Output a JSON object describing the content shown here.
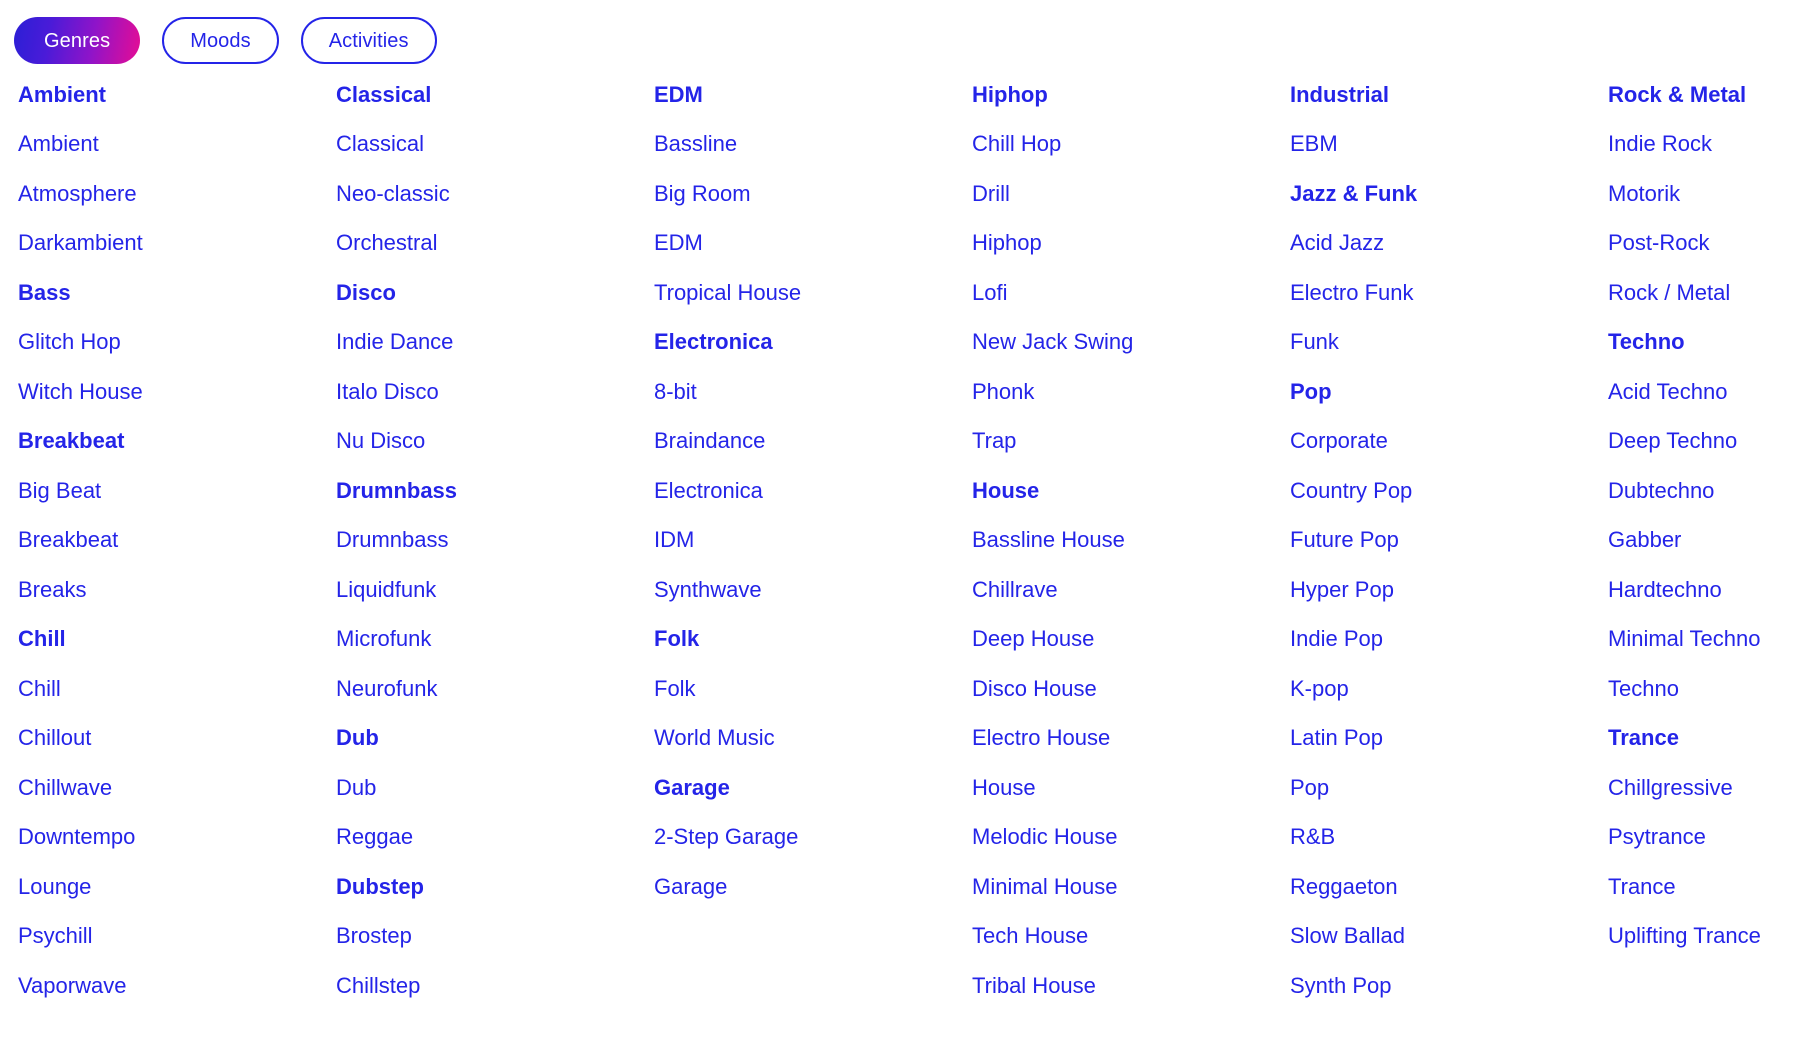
{
  "tabs": [
    {
      "label": "Genres",
      "active": true
    },
    {
      "label": "Moods",
      "active": false
    },
    {
      "label": "Activities",
      "active": false
    }
  ],
  "colors": {
    "link": "#2424e8",
    "pill_gradient_start": "#2b1fd6",
    "pill_gradient_end": "#e60c94",
    "pill_border": "#2424e8",
    "background": "#ffffff"
  },
  "columns": [
    {
      "entries": [
        {
          "type": "group",
          "label": "Ambient"
        },
        {
          "type": "item",
          "label": "Ambient"
        },
        {
          "type": "item",
          "label": "Atmosphere"
        },
        {
          "type": "item",
          "label": "Darkambient"
        },
        {
          "type": "group",
          "label": "Bass"
        },
        {
          "type": "item",
          "label": "Glitch Hop"
        },
        {
          "type": "item",
          "label": "Witch House"
        },
        {
          "type": "group",
          "label": "Breakbeat"
        },
        {
          "type": "item",
          "label": "Big Beat"
        },
        {
          "type": "item",
          "label": "Breakbeat"
        },
        {
          "type": "item",
          "label": "Breaks"
        },
        {
          "type": "group",
          "label": "Chill"
        },
        {
          "type": "item",
          "label": "Chill"
        },
        {
          "type": "item",
          "label": "Chillout"
        },
        {
          "type": "item",
          "label": "Chillwave"
        },
        {
          "type": "item",
          "label": "Downtempo"
        },
        {
          "type": "item",
          "label": "Lounge"
        },
        {
          "type": "item",
          "label": "Psychill"
        },
        {
          "type": "item",
          "label": "Vaporwave"
        }
      ]
    },
    {
      "entries": [
        {
          "type": "group",
          "label": "Classical"
        },
        {
          "type": "item",
          "label": "Classical"
        },
        {
          "type": "item",
          "label": "Neo-classic"
        },
        {
          "type": "item",
          "label": "Orchestral"
        },
        {
          "type": "group",
          "label": "Disco"
        },
        {
          "type": "item",
          "label": "Indie Dance"
        },
        {
          "type": "item",
          "label": "Italo Disco"
        },
        {
          "type": "item",
          "label": "Nu Disco"
        },
        {
          "type": "group",
          "label": "Drumnbass"
        },
        {
          "type": "item",
          "label": "Drumnbass"
        },
        {
          "type": "item",
          "label": "Liquidfunk"
        },
        {
          "type": "item",
          "label": "Microfunk"
        },
        {
          "type": "item",
          "label": "Neurofunk"
        },
        {
          "type": "group",
          "label": "Dub"
        },
        {
          "type": "item",
          "label": "Dub"
        },
        {
          "type": "item",
          "label": "Reggae"
        },
        {
          "type": "group",
          "label": "Dubstep"
        },
        {
          "type": "item",
          "label": "Brostep"
        },
        {
          "type": "item",
          "label": "Chillstep"
        }
      ]
    },
    {
      "entries": [
        {
          "type": "group",
          "label": "EDM"
        },
        {
          "type": "item",
          "label": "Bassline"
        },
        {
          "type": "item",
          "label": "Big Room"
        },
        {
          "type": "item",
          "label": "EDM"
        },
        {
          "type": "item",
          "label": "Tropical House"
        },
        {
          "type": "group",
          "label": "Electronica"
        },
        {
          "type": "item",
          "label": "8-bit"
        },
        {
          "type": "item",
          "label": "Braindance"
        },
        {
          "type": "item",
          "label": "Electronica"
        },
        {
          "type": "item",
          "label": "IDM"
        },
        {
          "type": "item",
          "label": "Synthwave"
        },
        {
          "type": "group",
          "label": "Folk"
        },
        {
          "type": "item",
          "label": "Folk"
        },
        {
          "type": "item",
          "label": "World Music"
        },
        {
          "type": "group",
          "label": "Garage"
        },
        {
          "type": "item",
          "label": "2-Step Garage"
        },
        {
          "type": "item",
          "label": "Garage"
        }
      ]
    },
    {
      "entries": [
        {
          "type": "group",
          "label": "Hiphop"
        },
        {
          "type": "item",
          "label": "Chill Hop"
        },
        {
          "type": "item",
          "label": "Drill"
        },
        {
          "type": "item",
          "label": "Hiphop"
        },
        {
          "type": "item",
          "label": "Lofi"
        },
        {
          "type": "item",
          "label": "New Jack Swing"
        },
        {
          "type": "item",
          "label": "Phonk"
        },
        {
          "type": "item",
          "label": "Trap"
        },
        {
          "type": "group",
          "label": "House"
        },
        {
          "type": "item",
          "label": "Bassline House"
        },
        {
          "type": "item",
          "label": "Chillrave"
        },
        {
          "type": "item",
          "label": "Deep House"
        },
        {
          "type": "item",
          "label": "Disco House"
        },
        {
          "type": "item",
          "label": "Electro House"
        },
        {
          "type": "item",
          "label": "House"
        },
        {
          "type": "item",
          "label": "Melodic House"
        },
        {
          "type": "item",
          "label": "Minimal House"
        },
        {
          "type": "item",
          "label": "Tech House"
        },
        {
          "type": "item",
          "label": "Tribal House"
        }
      ]
    },
    {
      "entries": [
        {
          "type": "group",
          "label": "Industrial"
        },
        {
          "type": "item",
          "label": "EBM"
        },
        {
          "type": "group",
          "label": "Jazz & Funk"
        },
        {
          "type": "item",
          "label": "Acid Jazz"
        },
        {
          "type": "item",
          "label": "Electro Funk"
        },
        {
          "type": "item",
          "label": "Funk"
        },
        {
          "type": "group",
          "label": "Pop"
        },
        {
          "type": "item",
          "label": "Corporate"
        },
        {
          "type": "item",
          "label": "Country Pop"
        },
        {
          "type": "item",
          "label": "Future Pop"
        },
        {
          "type": "item",
          "label": "Hyper Pop"
        },
        {
          "type": "item",
          "label": "Indie Pop"
        },
        {
          "type": "item",
          "label": "K-pop"
        },
        {
          "type": "item",
          "label": "Latin Pop"
        },
        {
          "type": "item",
          "label": "Pop"
        },
        {
          "type": "item",
          "label": "R&B"
        },
        {
          "type": "item",
          "label": "Reggaeton"
        },
        {
          "type": "item",
          "label": "Slow Ballad"
        },
        {
          "type": "item",
          "label": "Synth Pop"
        }
      ]
    },
    {
      "entries": [
        {
          "type": "group",
          "label": "Rock & Metal"
        },
        {
          "type": "item",
          "label": "Indie Rock"
        },
        {
          "type": "item",
          "label": "Motorik"
        },
        {
          "type": "item",
          "label": "Post-Rock"
        },
        {
          "type": "item",
          "label": "Rock / Metal"
        },
        {
          "type": "group",
          "label": "Techno"
        },
        {
          "type": "item",
          "label": "Acid Techno"
        },
        {
          "type": "item",
          "label": "Deep Techno"
        },
        {
          "type": "item",
          "label": "Dubtechno"
        },
        {
          "type": "item",
          "label": "Gabber"
        },
        {
          "type": "item",
          "label": "Hardtechno"
        },
        {
          "type": "item",
          "label": "Minimal Techno"
        },
        {
          "type": "item",
          "label": "Techno"
        },
        {
          "type": "group",
          "label": "Trance"
        },
        {
          "type": "item",
          "label": "Chillgressive"
        },
        {
          "type": "item",
          "label": "Psytrance"
        },
        {
          "type": "item",
          "label": "Trance"
        },
        {
          "type": "item",
          "label": "Uplifting Trance"
        }
      ]
    }
  ]
}
